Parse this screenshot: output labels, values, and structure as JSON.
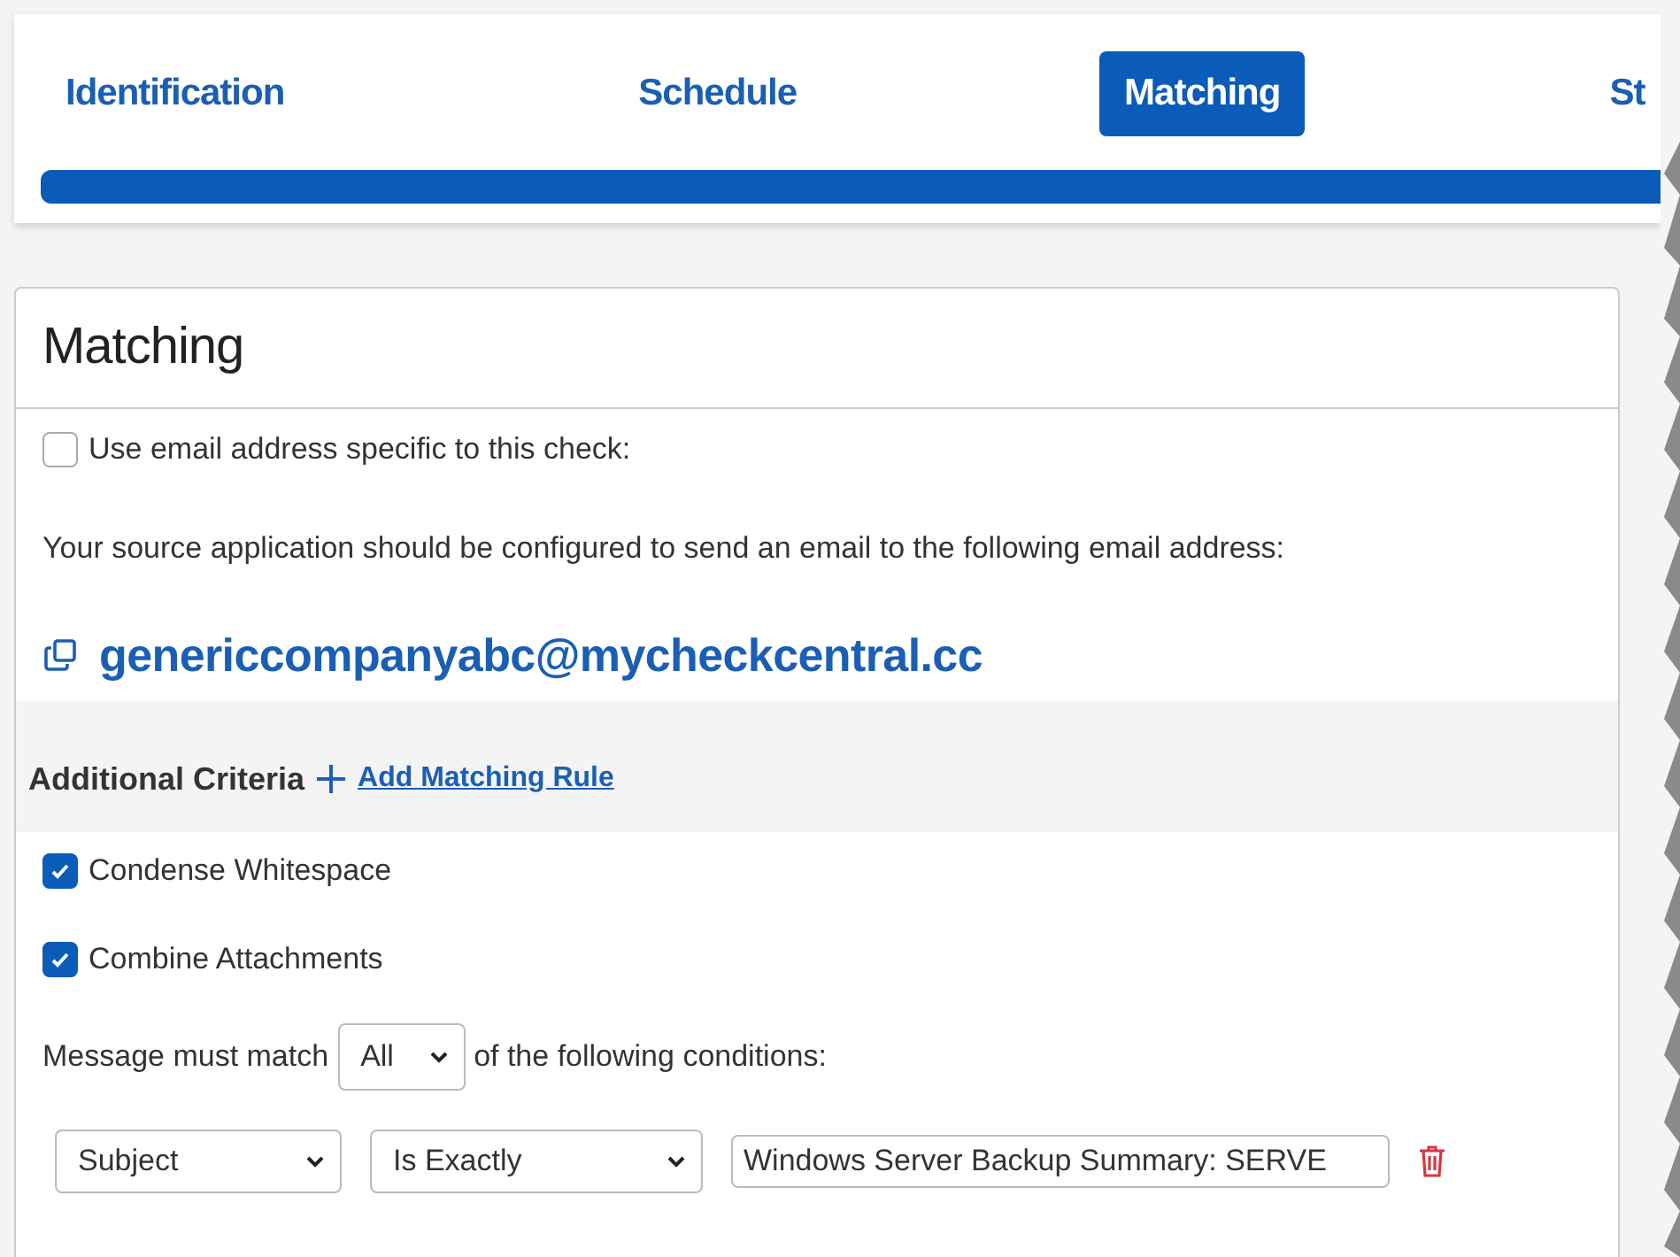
{
  "steps": [
    {
      "label": "Identification",
      "selected": false
    },
    {
      "label": "Schedule",
      "selected": false
    },
    {
      "label": "Matching",
      "selected": true
    },
    {
      "label": "St",
      "selected": false
    }
  ],
  "progress": {
    "level": 1
  },
  "panel": {
    "title": "Matching",
    "specific_address": {
      "label": "Use email address specific to this check:",
      "checked": false
    },
    "instruction": "Your source application should be configured to send an email to the following email address:",
    "email": "genericcompanyabc@mycheckcentral.cc",
    "criteria": {
      "title": "Additional Criteria",
      "add_link": "Add Matching Rule"
    },
    "options": [
      {
        "label": "Condense Whitespace",
        "checked": true
      },
      {
        "label": "Combine Attachments",
        "checked": true
      }
    ],
    "match": {
      "before": "Message must match",
      "value": "All",
      "after": "of the following conditions:"
    },
    "conditions": [
      {
        "field": "Subject",
        "operator": "Is Exactly",
        "value": "Windows Server Backup Summary: SERVE"
      }
    ]
  }
}
